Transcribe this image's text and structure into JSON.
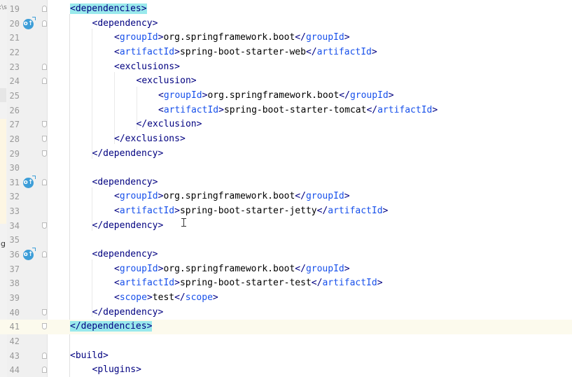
{
  "left_strip_fragments": [
    ":\\s",
    "ig"
  ],
  "lines": [
    {
      "num": "19",
      "indent": 0,
      "parts": [
        {
          "t": "<",
          "c": "bracket",
          "h": true
        },
        {
          "t": "dependencies",
          "c": "tname",
          "h": true
        },
        {
          "t": ">",
          "c": "bracket",
          "h": true
        }
      ],
      "icon": "",
      "fold": "start"
    },
    {
      "num": "20",
      "indent": 1,
      "parts": [
        {
          "t": "<",
          "c": "bracket"
        },
        {
          "t": "dependency",
          "c": "tname"
        },
        {
          "t": ">",
          "c": "bracket"
        }
      ],
      "icon": "o↑",
      "fold": "start"
    },
    {
      "num": "21",
      "indent": 2,
      "parts": [
        {
          "t": "<",
          "c": "bracket"
        },
        {
          "t": "groupId",
          "c": "tname key"
        },
        {
          "t": ">",
          "c": "bracket"
        },
        {
          "t": "org.springframework.boot",
          "c": ""
        },
        {
          "t": "</",
          "c": "bracket"
        },
        {
          "t": "groupId",
          "c": "tname key"
        },
        {
          "t": ">",
          "c": "bracket"
        }
      ],
      "icon": "",
      "fold": ""
    },
    {
      "num": "22",
      "indent": 2,
      "parts": [
        {
          "t": "<",
          "c": "bracket"
        },
        {
          "t": "artifactId",
          "c": "tname key"
        },
        {
          "t": ">",
          "c": "bracket"
        },
        {
          "t": "spring-boot-starter-web",
          "c": ""
        },
        {
          "t": "</",
          "c": "bracket"
        },
        {
          "t": "artifactId",
          "c": "tname key"
        },
        {
          "t": ">",
          "c": "bracket"
        }
      ],
      "icon": "",
      "fold": ""
    },
    {
      "num": "23",
      "indent": 2,
      "parts": [
        {
          "t": "<",
          "c": "bracket"
        },
        {
          "t": "exclusions",
          "c": "tname"
        },
        {
          "t": ">",
          "c": "bracket"
        }
      ],
      "icon": "",
      "fold": "start"
    },
    {
      "num": "24",
      "indent": 3,
      "parts": [
        {
          "t": "<",
          "c": "bracket"
        },
        {
          "t": "exclusion",
          "c": "tname"
        },
        {
          "t": ">",
          "c": "bracket"
        }
      ],
      "icon": "",
      "fold": "start"
    },
    {
      "num": "25",
      "indent": 4,
      "parts": [
        {
          "t": "<",
          "c": "bracket"
        },
        {
          "t": "groupId",
          "c": "tname key"
        },
        {
          "t": ">",
          "c": "bracket"
        },
        {
          "t": "org.springframework.boot",
          "c": ""
        },
        {
          "t": "</",
          "c": "bracket"
        },
        {
          "t": "groupId",
          "c": "tname key"
        },
        {
          "t": ">",
          "c": "bracket"
        }
      ],
      "icon": "",
      "fold": ""
    },
    {
      "num": "26",
      "indent": 4,
      "parts": [
        {
          "t": "<",
          "c": "bracket"
        },
        {
          "t": "artifactId",
          "c": "tname key"
        },
        {
          "t": ">",
          "c": "bracket"
        },
        {
          "t": "spring-boot-starter-tomcat",
          "c": ""
        },
        {
          "t": "</",
          "c": "bracket"
        },
        {
          "t": "artifactId",
          "c": "tname key"
        },
        {
          "t": ">",
          "c": "bracket"
        }
      ],
      "icon": "",
      "fold": ""
    },
    {
      "num": "27",
      "indent": 3,
      "parts": [
        {
          "t": "</",
          "c": "bracket"
        },
        {
          "t": "exclusion",
          "c": "tname"
        },
        {
          "t": ">",
          "c": "bracket"
        }
      ],
      "icon": "",
      "fold": "end"
    },
    {
      "num": "28",
      "indent": 2,
      "parts": [
        {
          "t": "</",
          "c": "bracket"
        },
        {
          "t": "exclusions",
          "c": "tname"
        },
        {
          "t": ">",
          "c": "bracket"
        }
      ],
      "icon": "",
      "fold": "end"
    },
    {
      "num": "29",
      "indent": 1,
      "parts": [
        {
          "t": "</",
          "c": "bracket"
        },
        {
          "t": "dependency",
          "c": "tname"
        },
        {
          "t": ">",
          "c": "bracket"
        }
      ],
      "icon": "",
      "fold": "end"
    },
    {
      "num": "30",
      "indent": 0,
      "parts": [],
      "icon": "",
      "fold": ""
    },
    {
      "num": "31",
      "indent": 1,
      "parts": [
        {
          "t": "<",
          "c": "bracket"
        },
        {
          "t": "dependency",
          "c": "tname"
        },
        {
          "t": ">",
          "c": "bracket"
        }
      ],
      "icon": "o↑",
      "fold": "start"
    },
    {
      "num": "32",
      "indent": 2,
      "parts": [
        {
          "t": "<",
          "c": "bracket"
        },
        {
          "t": "groupId",
          "c": "tname key"
        },
        {
          "t": ">",
          "c": "bracket"
        },
        {
          "t": "org.springframework.boot",
          "c": ""
        },
        {
          "t": "</",
          "c": "bracket"
        },
        {
          "t": "groupId",
          "c": "tname key"
        },
        {
          "t": ">",
          "c": "bracket"
        }
      ],
      "icon": "",
      "fold": ""
    },
    {
      "num": "33",
      "indent": 2,
      "parts": [
        {
          "t": "<",
          "c": "bracket"
        },
        {
          "t": "artifactId",
          "c": "tname key"
        },
        {
          "t": ">",
          "c": "bracket"
        },
        {
          "t": "spring-boot-starter-jetty",
          "c": ""
        },
        {
          "t": "</",
          "c": "bracket"
        },
        {
          "t": "artifactId",
          "c": "tname key"
        },
        {
          "t": ">",
          "c": "bracket"
        }
      ],
      "icon": "",
      "fold": ""
    },
    {
      "num": "34",
      "indent": 1,
      "parts": [
        {
          "t": "</",
          "c": "bracket"
        },
        {
          "t": "dependency",
          "c": "tname"
        },
        {
          "t": ">",
          "c": "bracket"
        }
      ],
      "icon": "",
      "fold": "end"
    },
    {
      "num": "35",
      "indent": 0,
      "parts": [],
      "icon": "",
      "fold": ""
    },
    {
      "num": "36",
      "indent": 1,
      "parts": [
        {
          "t": "<",
          "c": "bracket"
        },
        {
          "t": "dependency",
          "c": "tname"
        },
        {
          "t": ">",
          "c": "bracket"
        }
      ],
      "icon": "o↑",
      "fold": "start"
    },
    {
      "num": "37",
      "indent": 2,
      "parts": [
        {
          "t": "<",
          "c": "bracket"
        },
        {
          "t": "groupId",
          "c": "tname key"
        },
        {
          "t": ">",
          "c": "bracket"
        },
        {
          "t": "org.springframework.boot",
          "c": ""
        },
        {
          "t": "</",
          "c": "bracket"
        },
        {
          "t": "groupId",
          "c": "tname key"
        },
        {
          "t": ">",
          "c": "bracket"
        }
      ],
      "icon": "",
      "fold": ""
    },
    {
      "num": "38",
      "indent": 2,
      "parts": [
        {
          "t": "<",
          "c": "bracket"
        },
        {
          "t": "artifactId",
          "c": "tname key"
        },
        {
          "t": ">",
          "c": "bracket"
        },
        {
          "t": "spring-boot-starter-test",
          "c": ""
        },
        {
          "t": "</",
          "c": "bracket"
        },
        {
          "t": "artifactId",
          "c": "tname key"
        },
        {
          "t": ">",
          "c": "bracket"
        }
      ],
      "icon": "",
      "fold": ""
    },
    {
      "num": "39",
      "indent": 2,
      "parts": [
        {
          "t": "<",
          "c": "bracket"
        },
        {
          "t": "scope",
          "c": "tname key"
        },
        {
          "t": ">",
          "c": "bracket"
        },
        {
          "t": "test",
          "c": ""
        },
        {
          "t": "</",
          "c": "bracket"
        },
        {
          "t": "scope",
          "c": "tname key"
        },
        {
          "t": ">",
          "c": "bracket"
        }
      ],
      "icon": "",
      "fold": ""
    },
    {
      "num": "40",
      "indent": 1,
      "parts": [
        {
          "t": "</",
          "c": "bracket"
        },
        {
          "t": "dependency",
          "c": "tname"
        },
        {
          "t": ">",
          "c": "bracket"
        }
      ],
      "icon": "",
      "fold": "end"
    },
    {
      "num": "41",
      "indent": 0,
      "parts": [
        {
          "t": "</",
          "c": "bracket",
          "h": true
        },
        {
          "t": "dependencies",
          "c": "tname",
          "h": true
        },
        {
          "t": ">",
          "c": "bracket",
          "h": true
        }
      ],
      "icon": "",
      "fold": "end",
      "current": true
    },
    {
      "num": "42",
      "indent": 0,
      "parts": [],
      "icon": "",
      "fold": ""
    },
    {
      "num": "43",
      "indent": 0,
      "parts": [
        {
          "t": "<",
          "c": "bracket"
        },
        {
          "t": "build",
          "c": "tname"
        },
        {
          "t": ">",
          "c": "bracket"
        }
      ],
      "icon": "",
      "fold": "start"
    },
    {
      "num": "44",
      "indent": 1,
      "parts": [
        {
          "t": "<",
          "c": "bracket"
        },
        {
          "t": "plugins",
          "c": "tname"
        },
        {
          "t": ">",
          "c": "bracket"
        }
      ],
      "icon": "",
      "fold": "start"
    }
  ],
  "colors": {
    "tag": "#000080",
    "key_tag": "#1750eb",
    "match_highlight": "#99e9ec",
    "current_line": "#fcfaed",
    "gutter": "#f0f0f0",
    "bean_icon": "#3d9ed8"
  }
}
